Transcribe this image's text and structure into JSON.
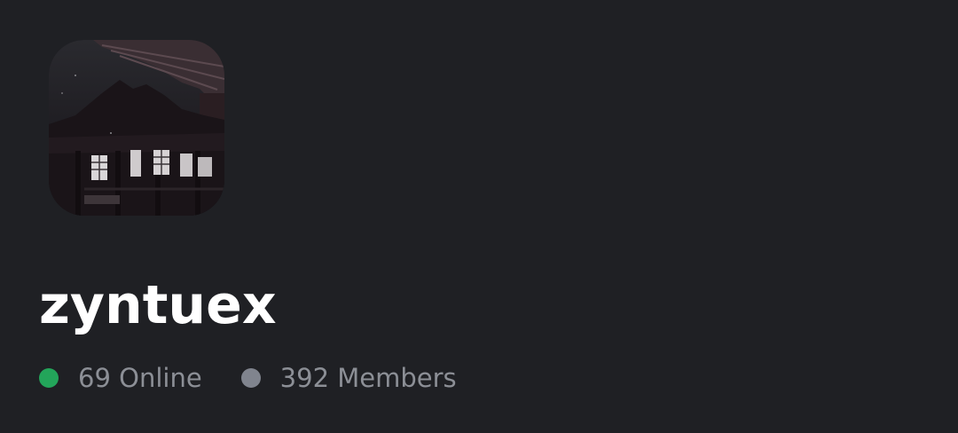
{
  "server": {
    "name": "zyntuex",
    "online_label": "69 Online",
    "members_label": "392 Members",
    "online_count": 69,
    "member_count": 392,
    "icon": "server-icon-japanese-temple-night"
  },
  "colors": {
    "background": "#1f2024",
    "online_dot": "#23a55a",
    "members_dot": "#80848e",
    "name_text": "#ffffff",
    "stats_text": "#8c8f96"
  }
}
